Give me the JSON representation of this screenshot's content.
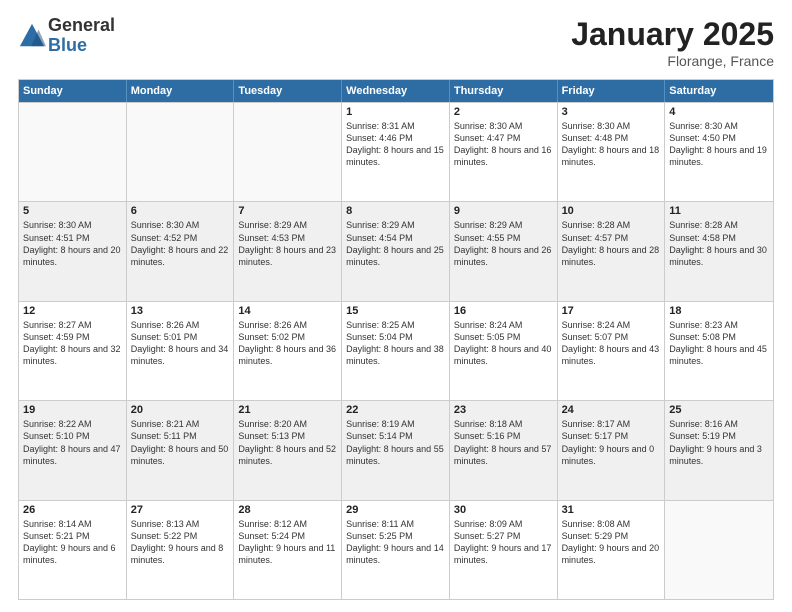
{
  "logo": {
    "general": "General",
    "blue": "Blue"
  },
  "title": {
    "month": "January 2025",
    "location": "Florange, France"
  },
  "header_days": [
    "Sunday",
    "Monday",
    "Tuesday",
    "Wednesday",
    "Thursday",
    "Friday",
    "Saturday"
  ],
  "weeks": [
    [
      {
        "day": "",
        "empty": true
      },
      {
        "day": "",
        "empty": true
      },
      {
        "day": "",
        "empty": true
      },
      {
        "day": "1",
        "sunrise": "Sunrise: 8:31 AM",
        "sunset": "Sunset: 4:46 PM",
        "daylight": "Daylight: 8 hours and 15 minutes."
      },
      {
        "day": "2",
        "sunrise": "Sunrise: 8:30 AM",
        "sunset": "Sunset: 4:47 PM",
        "daylight": "Daylight: 8 hours and 16 minutes."
      },
      {
        "day": "3",
        "sunrise": "Sunrise: 8:30 AM",
        "sunset": "Sunset: 4:48 PM",
        "daylight": "Daylight: 8 hours and 18 minutes."
      },
      {
        "day": "4",
        "sunrise": "Sunrise: 8:30 AM",
        "sunset": "Sunset: 4:50 PM",
        "daylight": "Daylight: 8 hours and 19 minutes."
      }
    ],
    [
      {
        "day": "5",
        "sunrise": "Sunrise: 8:30 AM",
        "sunset": "Sunset: 4:51 PM",
        "daylight": "Daylight: 8 hours and 20 minutes."
      },
      {
        "day": "6",
        "sunrise": "Sunrise: 8:30 AM",
        "sunset": "Sunset: 4:52 PM",
        "daylight": "Daylight: 8 hours and 22 minutes."
      },
      {
        "day": "7",
        "sunrise": "Sunrise: 8:29 AM",
        "sunset": "Sunset: 4:53 PM",
        "daylight": "Daylight: 8 hours and 23 minutes."
      },
      {
        "day": "8",
        "sunrise": "Sunrise: 8:29 AM",
        "sunset": "Sunset: 4:54 PM",
        "daylight": "Daylight: 8 hours and 25 minutes."
      },
      {
        "day": "9",
        "sunrise": "Sunrise: 8:29 AM",
        "sunset": "Sunset: 4:55 PM",
        "daylight": "Daylight: 8 hours and 26 minutes."
      },
      {
        "day": "10",
        "sunrise": "Sunrise: 8:28 AM",
        "sunset": "Sunset: 4:57 PM",
        "daylight": "Daylight: 8 hours and 28 minutes."
      },
      {
        "day": "11",
        "sunrise": "Sunrise: 8:28 AM",
        "sunset": "Sunset: 4:58 PM",
        "daylight": "Daylight: 8 hours and 30 minutes."
      }
    ],
    [
      {
        "day": "12",
        "sunrise": "Sunrise: 8:27 AM",
        "sunset": "Sunset: 4:59 PM",
        "daylight": "Daylight: 8 hours and 32 minutes."
      },
      {
        "day": "13",
        "sunrise": "Sunrise: 8:26 AM",
        "sunset": "Sunset: 5:01 PM",
        "daylight": "Daylight: 8 hours and 34 minutes."
      },
      {
        "day": "14",
        "sunrise": "Sunrise: 8:26 AM",
        "sunset": "Sunset: 5:02 PM",
        "daylight": "Daylight: 8 hours and 36 minutes."
      },
      {
        "day": "15",
        "sunrise": "Sunrise: 8:25 AM",
        "sunset": "Sunset: 5:04 PM",
        "daylight": "Daylight: 8 hours and 38 minutes."
      },
      {
        "day": "16",
        "sunrise": "Sunrise: 8:24 AM",
        "sunset": "Sunset: 5:05 PM",
        "daylight": "Daylight: 8 hours and 40 minutes."
      },
      {
        "day": "17",
        "sunrise": "Sunrise: 8:24 AM",
        "sunset": "Sunset: 5:07 PM",
        "daylight": "Daylight: 8 hours and 43 minutes."
      },
      {
        "day": "18",
        "sunrise": "Sunrise: 8:23 AM",
        "sunset": "Sunset: 5:08 PM",
        "daylight": "Daylight: 8 hours and 45 minutes."
      }
    ],
    [
      {
        "day": "19",
        "sunrise": "Sunrise: 8:22 AM",
        "sunset": "Sunset: 5:10 PM",
        "daylight": "Daylight: 8 hours and 47 minutes."
      },
      {
        "day": "20",
        "sunrise": "Sunrise: 8:21 AM",
        "sunset": "Sunset: 5:11 PM",
        "daylight": "Daylight: 8 hours and 50 minutes."
      },
      {
        "day": "21",
        "sunrise": "Sunrise: 8:20 AM",
        "sunset": "Sunset: 5:13 PM",
        "daylight": "Daylight: 8 hours and 52 minutes."
      },
      {
        "day": "22",
        "sunrise": "Sunrise: 8:19 AM",
        "sunset": "Sunset: 5:14 PM",
        "daylight": "Daylight: 8 hours and 55 minutes."
      },
      {
        "day": "23",
        "sunrise": "Sunrise: 8:18 AM",
        "sunset": "Sunset: 5:16 PM",
        "daylight": "Daylight: 8 hours and 57 minutes."
      },
      {
        "day": "24",
        "sunrise": "Sunrise: 8:17 AM",
        "sunset": "Sunset: 5:17 PM",
        "daylight": "Daylight: 9 hours and 0 minutes."
      },
      {
        "day": "25",
        "sunrise": "Sunrise: 8:16 AM",
        "sunset": "Sunset: 5:19 PM",
        "daylight": "Daylight: 9 hours and 3 minutes."
      }
    ],
    [
      {
        "day": "26",
        "sunrise": "Sunrise: 8:14 AM",
        "sunset": "Sunset: 5:21 PM",
        "daylight": "Daylight: 9 hours and 6 minutes."
      },
      {
        "day": "27",
        "sunrise": "Sunrise: 8:13 AM",
        "sunset": "Sunset: 5:22 PM",
        "daylight": "Daylight: 9 hours and 8 minutes."
      },
      {
        "day": "28",
        "sunrise": "Sunrise: 8:12 AM",
        "sunset": "Sunset: 5:24 PM",
        "daylight": "Daylight: 9 hours and 11 minutes."
      },
      {
        "day": "29",
        "sunrise": "Sunrise: 8:11 AM",
        "sunset": "Sunset: 5:25 PM",
        "daylight": "Daylight: 9 hours and 14 minutes."
      },
      {
        "day": "30",
        "sunrise": "Sunrise: 8:09 AM",
        "sunset": "Sunset: 5:27 PM",
        "daylight": "Daylight: 9 hours and 17 minutes."
      },
      {
        "day": "31",
        "sunrise": "Sunrise: 8:08 AM",
        "sunset": "Sunset: 5:29 PM",
        "daylight": "Daylight: 9 hours and 20 minutes."
      },
      {
        "day": "",
        "empty": true
      }
    ]
  ]
}
